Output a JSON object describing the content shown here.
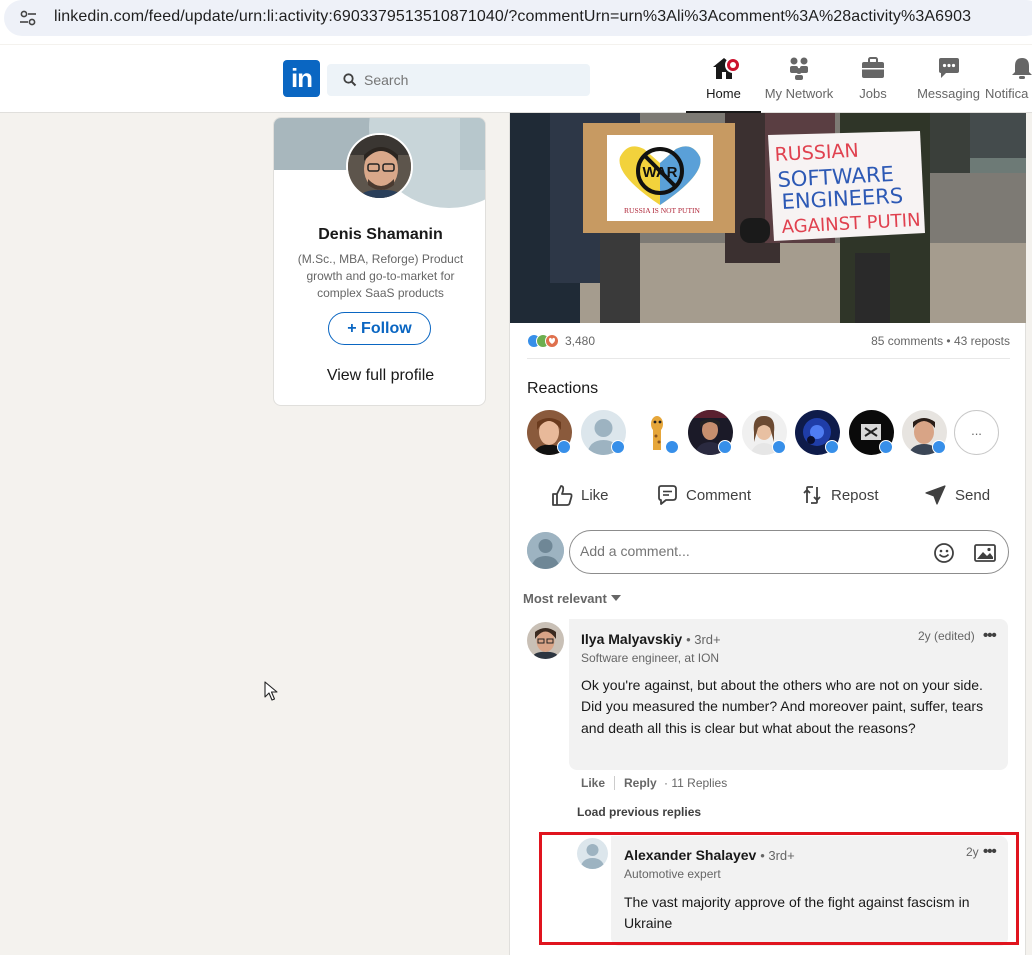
{
  "browser": {
    "url": "linkedin.com/feed/update/urn:li:activity:6903379513510871040/?commentUrn=urn%3Ali%3Acomment%3A%28activity%3A6903"
  },
  "header": {
    "logo": "in",
    "search_placeholder": "Search",
    "nav": [
      {
        "label": "Home",
        "icon": "home-icon",
        "active": true
      },
      {
        "label": "My Network",
        "icon": "network-icon"
      },
      {
        "label": "Jobs",
        "icon": "jobs-icon"
      },
      {
        "label": "Messaging",
        "icon": "messaging-icon"
      },
      {
        "label": "Notifica",
        "icon": "bell-icon"
      }
    ]
  },
  "profile": {
    "name": "Denis Shamanin",
    "headline": "(M.Sc., MBA, Reforge) Product growth and go-to-market for complex SaaS products",
    "follow_label": "+ Follow",
    "view_profile_label": "View full profile"
  },
  "post": {
    "image_signs": {
      "left_sign_top": "WAR",
      "left_sign_bottom": "RUSSIA IS NOT PUTIN",
      "right_sign": [
        "RUSSIAN",
        "SOFTWARE",
        "ENGINEERS",
        "AGAINST PUTIN"
      ]
    },
    "reaction_count": "3,480",
    "comments_reposts": "85 comments • 43 reposts",
    "reactions_title": "Reactions",
    "reactors_more": "...",
    "actions": {
      "like": "Like",
      "comment": "Comment",
      "repost": "Repost",
      "send": "Send"
    },
    "composer_placeholder": "Add a comment...",
    "sort_label": "Most relevant"
  },
  "comments": [
    {
      "name": "Ilya Malyavskiy",
      "degree": "• 3rd+",
      "subtitle": "Software engineer, at ION",
      "time": "2y (edited)",
      "more": "•••",
      "text": "Ok you're against, but about the others who are not on your side. Did you measured the number? And moreover paint, suffer, tears and death all this is clear but what about the reasons?",
      "like_label": "Like",
      "reply_label": "Reply",
      "replies_label": "· 11 Replies"
    }
  ],
  "load_previous": "Load previous replies",
  "reply": {
    "name": "Alexander Shalayev",
    "degree": "• 3rd+",
    "subtitle": "Automotive expert",
    "time": "2y",
    "more": "•••",
    "text": "The vast majority approve of the fight against fascism in Ukraine"
  },
  "colors": {
    "brand": "#0a66c2",
    "highlight": "#e0141e",
    "notification": "#cb112d"
  }
}
